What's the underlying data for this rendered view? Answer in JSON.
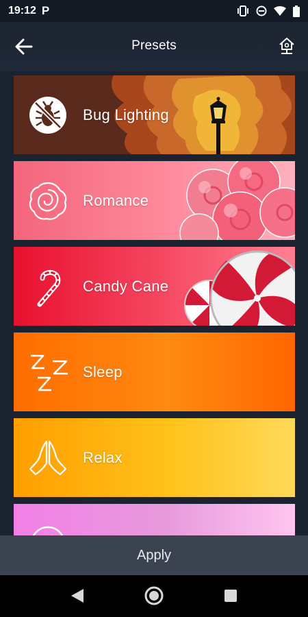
{
  "status": {
    "time": "19:12",
    "indicator": "P"
  },
  "header": {
    "title": "Presets"
  },
  "presets": [
    {
      "label": "Bug Lighting",
      "icon": "bug-icon"
    },
    {
      "label": "Romance",
      "icon": "rose-icon"
    },
    {
      "label": "Candy Cane",
      "icon": "candy-cane-icon"
    },
    {
      "label": "Sleep",
      "icon": "zzz-icon"
    },
    {
      "label": "Relax",
      "icon": "praying-hands-icon"
    },
    {
      "label": "",
      "icon": "partial-icon"
    }
  ],
  "footer": {
    "apply_label": "Apply"
  }
}
